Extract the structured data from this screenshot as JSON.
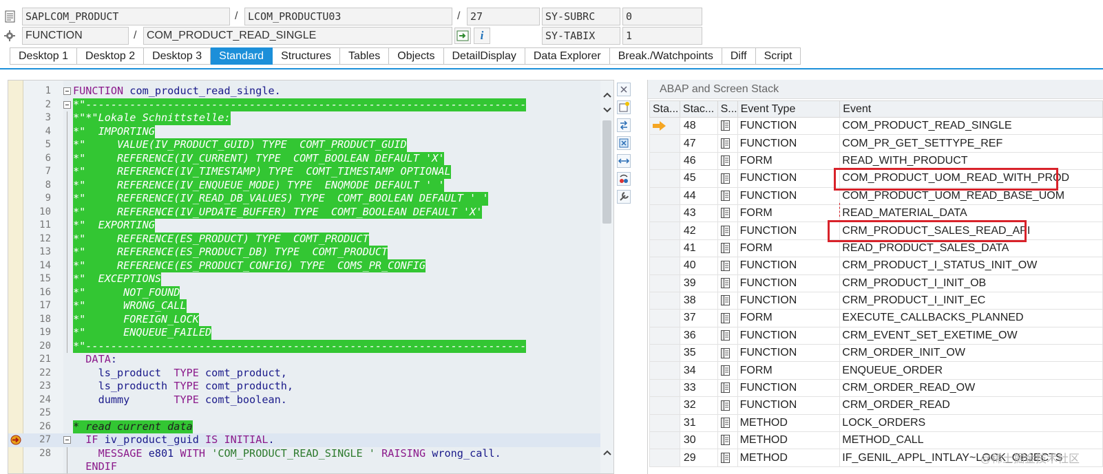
{
  "header": {
    "program": "SAPLCOM_PRODUCT",
    "include": "LCOM_PRODUCTU03",
    "line_no": "27",
    "event_type": "FUNCTION",
    "event_name": "COM_PRODUCT_READ_SINGLE",
    "separator": "/",
    "sysvars": [
      {
        "name": "SY-SUBRC",
        "value": "0"
      },
      {
        "name": "SY-TABIX",
        "value": "1"
      }
    ],
    "info_button": "i"
  },
  "tabs": [
    "Desktop 1",
    "Desktop 2",
    "Desktop 3",
    "Standard",
    "Structures",
    "Tables",
    "Objects",
    "DetailDisplay",
    "Data Explorer",
    "Break./Watchpoints",
    "Diff",
    "Script"
  ],
  "active_tab": "Standard",
  "code": {
    "line_numbers": [
      "1",
      "2",
      "3",
      "4",
      "5",
      "6",
      "7",
      "8",
      "9",
      "10",
      "11",
      "12",
      "13",
      "14",
      "15",
      "16",
      "17",
      "18",
      "19",
      "20",
      "21",
      "22",
      "23",
      "24",
      "25",
      "26",
      "27",
      "28"
    ],
    "l1_kw": "FUNCTION",
    "l1_rest": " com_product_read_single.",
    "l2": "*\"----------------------------------------------------------------------",
    "l3": "*\"*\"Lokale Schnittstelle:",
    "l4": "*\"  IMPORTING",
    "l5": "*\"     VALUE(IV_PRODUCT_GUID) TYPE  COMT_PRODUCT_GUID",
    "l6": "*\"     REFERENCE(IV_CURRENT) TYPE  COMT_BOOLEAN DEFAULT 'X'",
    "l7": "*\"     REFERENCE(IV_TIMESTAMP) TYPE  COMT_TIMESTAMP OPTIONAL",
    "l8": "*\"     REFERENCE(IV_ENQUEUE_MODE) TYPE  ENQMODE DEFAULT ' '",
    "l9": "*\"     REFERENCE(IV_READ_DB_VALUES) TYPE  COMT_BOOLEAN DEFAULT ' '",
    "l10": "*\"     REFERENCE(IV_UPDATE_BUFFER) TYPE  COMT_BOOLEAN DEFAULT 'X'",
    "l11": "*\"  EXPORTING",
    "l12": "*\"     REFERENCE(ES_PRODUCT) TYPE  COMT_PRODUCT",
    "l13": "*\"     REFERENCE(ES_PRODUCT_DB) TYPE  COMT_PRODUCT",
    "l14": "*\"     REFERENCE(ES_PRODUCT_CONFIG) TYPE  COMS_PR_CONFIG",
    "l15": "*\"  EXCEPTIONS",
    "l16": "*\"      NOT_FOUND",
    "l17": "*\"      WRONG_CALL",
    "l18": "*\"      FOREIGN_LOCK",
    "l19": "*\"      ENQUEUE_FAILED",
    "l20": "*\"----------------------------------------------------------------------",
    "l21_kw": "  DATA",
    "l21_rest": ":",
    "l22_a": "    ls_product  ",
    "l22_kw": "TYPE",
    "l22_b": " comt_product,",
    "l23_a": "    ls_producth ",
    "l23_kw": "TYPE",
    "l23_b": " comt_producth,",
    "l24_a": "    dummy       ",
    "l24_kw": "TYPE",
    "l24_b": " comt_boolean.",
    "l26": "* read current data",
    "l27_kw1": "  IF",
    "l27_a": " iv_product_guid ",
    "l27_kw2": "IS INITIAL",
    "l27_b": ".",
    "l28_kw1": "    MESSAGE",
    "l28_a": " e801 ",
    "l28_kw2": "WITH",
    "l28_str": " 'COM_PRODUCT_READ_SINGLE '",
    "l28_kw3": " RAISING",
    "l28_b": " wrong_call.",
    "l29": "  ENDIF"
  },
  "stack": {
    "title": "ABAP and Screen Stack",
    "columns": [
      "Sta...",
      "Stac...",
      "S...",
      "Event Type",
      "Event"
    ],
    "current_row_index": 0,
    "rows": [
      {
        "level": "48",
        "type": "FUNCTION",
        "event": "COM_PRODUCT_READ_SINGLE"
      },
      {
        "level": "47",
        "type": "FUNCTION",
        "event": "COM_PR_GET_SETTYPE_REF"
      },
      {
        "level": "46",
        "type": "FORM",
        "event": "READ_WITH_PRODUCT"
      },
      {
        "level": "45",
        "type": "FUNCTION",
        "event": "COM_PRODUCT_UOM_READ_WITH_PROD"
      },
      {
        "level": "44",
        "type": "FUNCTION",
        "event": "COM_PRODUCT_UOM_READ_BASE_UOM"
      },
      {
        "level": "43",
        "type": "FORM",
        "event": "READ_MATERIAL_DATA"
      },
      {
        "level": "42",
        "type": "FUNCTION",
        "event": "CRM_PRODUCT_SALES_READ_API"
      },
      {
        "level": "41",
        "type": "FORM",
        "event": "READ_PRODUCT_SALES_DATA"
      },
      {
        "level": "40",
        "type": "FUNCTION",
        "event": "CRM_PRODUCT_I_STATUS_INIT_OW"
      },
      {
        "level": "39",
        "type": "FUNCTION",
        "event": "CRM_PRODUCT_I_INIT_OB"
      },
      {
        "level": "38",
        "type": "FUNCTION",
        "event": "CRM_PRODUCT_I_INIT_EC"
      },
      {
        "level": "37",
        "type": "FORM",
        "event": "EXECUTE_CALLBACKS_PLANNED"
      },
      {
        "level": "36",
        "type": "FUNCTION",
        "event": "CRM_EVENT_SET_EXETIME_OW"
      },
      {
        "level": "35",
        "type": "FUNCTION",
        "event": "CRM_ORDER_INIT_OW"
      },
      {
        "level": "34",
        "type": "FORM",
        "event": "ENQUEUE_ORDER"
      },
      {
        "level": "33",
        "type": "FUNCTION",
        "event": "CRM_ORDER_READ_OW"
      },
      {
        "level": "32",
        "type": "FUNCTION",
        "event": "CRM_ORDER_READ"
      },
      {
        "level": "31",
        "type": "METHOD",
        "event": "LOCK_ORDERS"
      },
      {
        "level": "30",
        "type": "METHOD",
        "event": "METHOD_CALL"
      },
      {
        "level": "29",
        "type": "METHOD",
        "event": "IF_GENIL_APPL_INTLAY~LOCK_OBJECTS"
      }
    ]
  },
  "watermark": "@稀土掘金技术社区",
  "colors": {
    "accent": "#1c8fd9",
    "comment_bg": "#33c633",
    "highlight_box": "#d8222a"
  }
}
